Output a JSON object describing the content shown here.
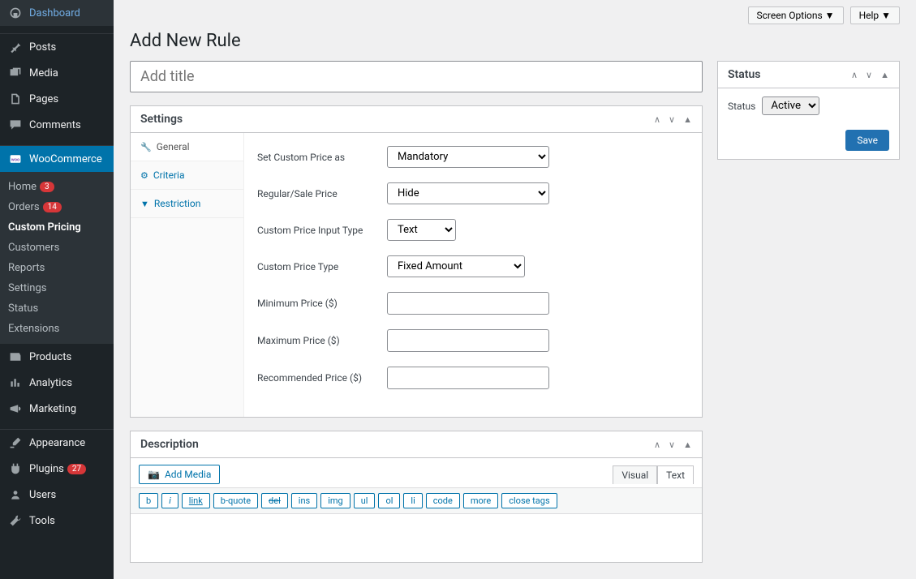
{
  "topbar": {
    "screen_options": "Screen Options ▼",
    "help": "Help ▼"
  },
  "page": {
    "title": "Add New Rule",
    "title_placeholder": "Add title"
  },
  "sidebar": {
    "dashboard": "Dashboard",
    "posts": "Posts",
    "media": "Media",
    "pages": "Pages",
    "comments": "Comments",
    "woocommerce": "WooCommerce",
    "products": "Products",
    "analytics": "Analytics",
    "marketing": "Marketing",
    "appearance": "Appearance",
    "plugins": "Plugins",
    "users": "Users",
    "tools": "Tools",
    "plugins_badge": "27"
  },
  "submenu": {
    "home": "Home",
    "home_badge": "3",
    "orders": "Orders",
    "orders_badge": "14",
    "custom_pricing": "Custom Pricing",
    "customers": "Customers",
    "reports": "Reports",
    "settings": "Settings",
    "status": "Status",
    "extensions": "Extensions"
  },
  "settings_box": {
    "title": "Settings",
    "tabs": {
      "general": "General",
      "criteria": "Criteria",
      "restriction": "Restriction"
    },
    "fields": {
      "set_custom_price_as": {
        "label": "Set Custom Price as",
        "value": "Mandatory"
      },
      "regular_sale_price": {
        "label": "Regular/Sale Price",
        "value": "Hide"
      },
      "custom_price_input_type": {
        "label": "Custom Price Input Type",
        "value": "Text"
      },
      "custom_price_type": {
        "label": "Custom Price Type",
        "value": "Fixed Amount"
      },
      "minimum_price": {
        "label": "Minimum Price ($)",
        "value": ""
      },
      "maximum_price": {
        "label": "Maximum Price ($)",
        "value": ""
      },
      "recommended_price": {
        "label": "Recommended Price ($)",
        "value": ""
      }
    }
  },
  "desc_box": {
    "title": "Description",
    "add_media": "Add Media",
    "tabs": {
      "visual": "Visual",
      "text": "Text"
    },
    "qt": [
      "b",
      "i",
      "link",
      "b-quote",
      "del",
      "ins",
      "img",
      "ul",
      "ol",
      "li",
      "code",
      "more",
      "close tags"
    ]
  },
  "status_box": {
    "title": "Status",
    "label": "Status",
    "value": "Active",
    "save": "Save"
  }
}
